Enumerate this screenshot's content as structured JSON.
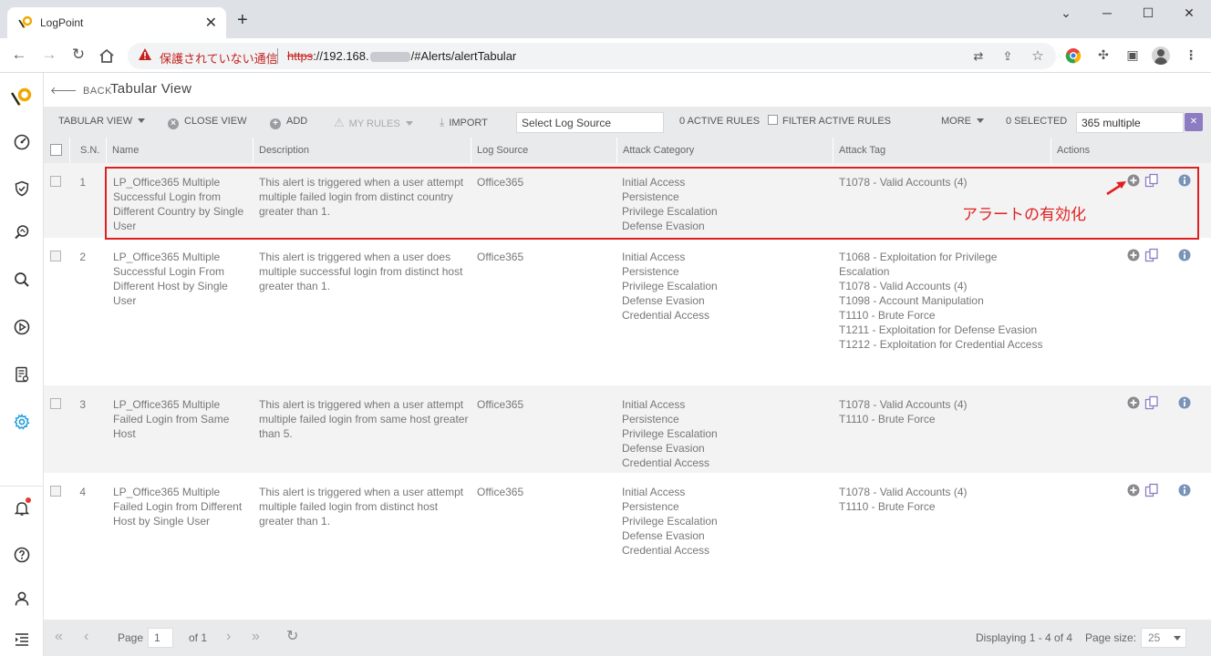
{
  "browser": {
    "tab_title": "LogPoint",
    "insecure_label": "保護されていない通信",
    "url_scheme": "https",
    "url_host": "://192.168.",
    "url_path": "/#Alerts/alertTabular"
  },
  "header": {
    "back_label": "BACK",
    "title": "Tabular View"
  },
  "actionbar": {
    "tabular_view": "TABULAR VIEW",
    "close_view": "CLOSE VIEW",
    "add": "ADD",
    "my_rules": "MY RULES",
    "import": "IMPORT",
    "log_source_placeholder": "Select Log Source",
    "active_rules": "0 ACTIVE RULES",
    "filter_active": "FILTER ACTIVE RULES",
    "more": "MORE",
    "selected": "0 SELECTED",
    "search_value": "365 multiple"
  },
  "table": {
    "headers": [
      "S.N.",
      "Name",
      "Description",
      "Log Source",
      "Attack Category",
      "Attack Tag",
      "Actions"
    ],
    "rows": [
      {
        "sn": "1",
        "name": "LP_Office365 Multiple Successful Login from Different Country by Single User",
        "description": "This alert is triggered when a user attempt multiple failed login from distinct country greater than 1.",
        "log_source": "Office365",
        "categories": "Initial Access\nPersistence\nPrivilege Escalation\nDefense Evasion",
        "tags": "T1078 - Valid Accounts (4)"
      },
      {
        "sn": "2",
        "name": "LP_Office365 Multiple Successful Login From Different Host by Single User",
        "description": "This alert is triggered when a user does multiple successful login from distinct host greater than 1.",
        "log_source": "Office365",
        "categories": "Initial Access\nPersistence\nPrivilege Escalation\nDefense Evasion\nCredential Access",
        "tags": "T1068 - Exploitation for Privilege Escalation\nT1078 - Valid Accounts (4)\nT1098 - Account Manipulation\nT1110 - Brute Force\nT1211 - Exploitation for Defense Evasion\nT1212 - Exploitation for Credential Access"
      },
      {
        "sn": "3",
        "name": "LP_Office365 Multiple Failed Login from Same Host",
        "description": "This alert is triggered when a user attempt multiple failed login from same host greater than 5.",
        "log_source": "Office365",
        "categories": "Initial Access\nPersistence\nPrivilege Escalation\nDefense Evasion\nCredential Access",
        "tags": "T1078 - Valid Accounts (4)\nT1110 - Brute Force"
      },
      {
        "sn": "4",
        "name": "LP_Office365 Multiple Failed Login from Different Host by Single User",
        "description": "This alert is triggered when a user attempt multiple failed login from distinct host greater than 1.",
        "log_source": "Office365",
        "categories": "Initial Access\nPersistence\nPrivilege Escalation\nDefense Evasion\nCredential Access",
        "tags": "T1078 - Valid Accounts (4)\nT1110 - Brute Force"
      }
    ]
  },
  "annotation": {
    "text": "アラートの有効化",
    "color": "#e02020"
  },
  "pager": {
    "page_label": "Page",
    "page_value": "1",
    "of_label": "of 1",
    "displaying": "Displaying 1 - 4 of 4",
    "page_size_label": "Page size:",
    "page_size": "25"
  },
  "colors": {
    "accent": "#8e7cc3",
    "active_nav": "#1a9bd7",
    "highlight": "#e02020"
  }
}
